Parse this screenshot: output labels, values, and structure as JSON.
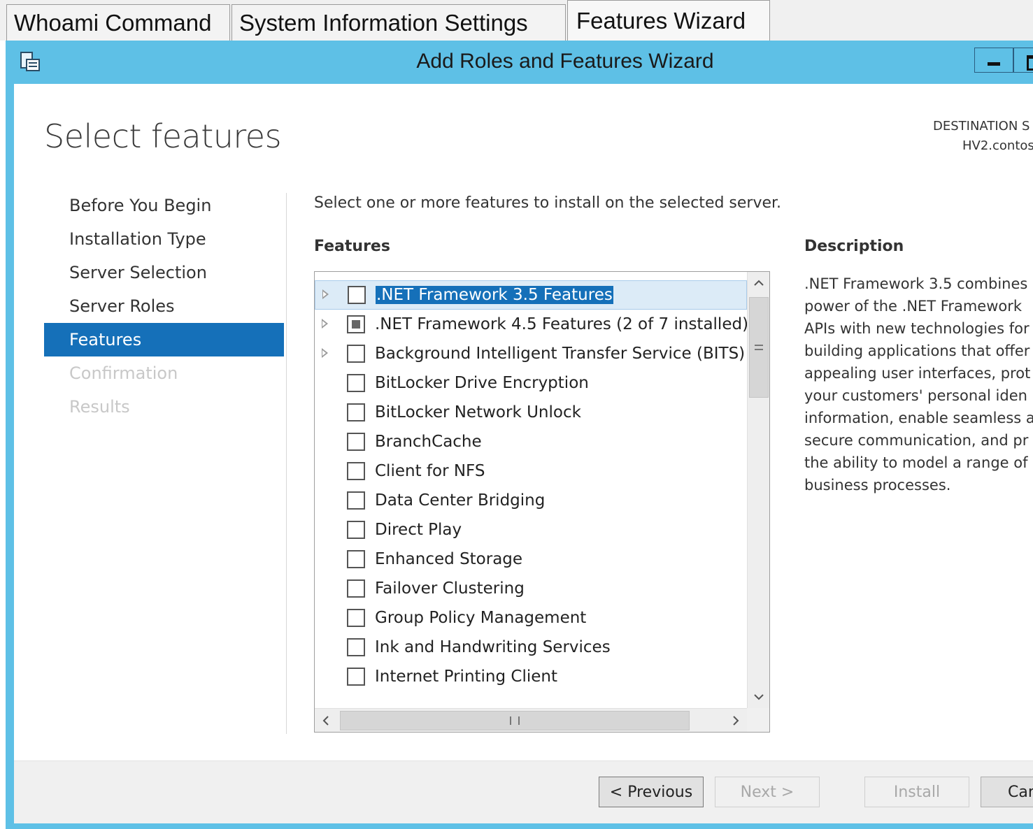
{
  "tabs": [
    {
      "label": "Whoami Command"
    },
    {
      "label": "System Information Settings"
    },
    {
      "label": "Features Wizard"
    }
  ],
  "window": {
    "title": "Add Roles and Features Wizard"
  },
  "page": {
    "title": "Select features",
    "destination_label": "DESTINATION S",
    "destination_value": "HV2.contos",
    "instruction": "Select one or more features to install on the selected server.",
    "features_heading": "Features",
    "description_heading": "Description",
    "description_text": ".NET Framework 3.5 combines\npower of the .NET Framework\nAPIs with new technologies for\nbuilding applications that offer\nappealing user interfaces, prot\nyour customers' personal iden\ninformation, enable seamless a\nsecure communication, and pr\nthe ability to model a range of\nbusiness processes."
  },
  "nav": [
    {
      "label": "Before You Begin",
      "state": "normal"
    },
    {
      "label": "Installation Type",
      "state": "normal"
    },
    {
      "label": "Server Selection",
      "state": "normal"
    },
    {
      "label": "Server Roles",
      "state": "normal"
    },
    {
      "label": "Features",
      "state": "active"
    },
    {
      "label": "Confirmation",
      "state": "disabled"
    },
    {
      "label": "Results",
      "state": "disabled"
    }
  ],
  "features": [
    {
      "label": ".NET Framework 3.5 Features",
      "expandable": true,
      "checked": "none",
      "selected": true
    },
    {
      "label": ".NET Framework 4.5 Features (2 of 7 installed)",
      "expandable": true,
      "checked": "partial",
      "selected": false
    },
    {
      "label": "Background Intelligent Transfer Service (BITS)",
      "expandable": true,
      "checked": "none",
      "selected": false
    },
    {
      "label": "BitLocker Drive Encryption",
      "expandable": false,
      "checked": "none",
      "selected": false
    },
    {
      "label": "BitLocker Network Unlock",
      "expandable": false,
      "checked": "none",
      "selected": false
    },
    {
      "label": "BranchCache",
      "expandable": false,
      "checked": "none",
      "selected": false
    },
    {
      "label": "Client for NFS",
      "expandable": false,
      "checked": "none",
      "selected": false
    },
    {
      "label": "Data Center Bridging",
      "expandable": false,
      "checked": "none",
      "selected": false
    },
    {
      "label": "Direct Play",
      "expandable": false,
      "checked": "none",
      "selected": false
    },
    {
      "label": "Enhanced Storage",
      "expandable": false,
      "checked": "none",
      "selected": false
    },
    {
      "label": "Failover Clustering",
      "expandable": false,
      "checked": "none",
      "selected": false
    },
    {
      "label": "Group Policy Management",
      "expandable": false,
      "checked": "none",
      "selected": false
    },
    {
      "label": "Ink and Handwriting Services",
      "expandable": false,
      "checked": "none",
      "selected": false
    },
    {
      "label": "Internet Printing Client",
      "expandable": false,
      "checked": "none",
      "selected": false
    }
  ],
  "scroll": {
    "up": "^",
    "down": "v",
    "left": "<",
    "right": ">"
  },
  "footer": {
    "previous": "< Previous",
    "next": "Next >",
    "install": "Install",
    "cancel": "Car"
  },
  "colors": {
    "titlebar": "#5ec0e6",
    "nav_active": "#1570b9",
    "selection": "#1570b9"
  }
}
